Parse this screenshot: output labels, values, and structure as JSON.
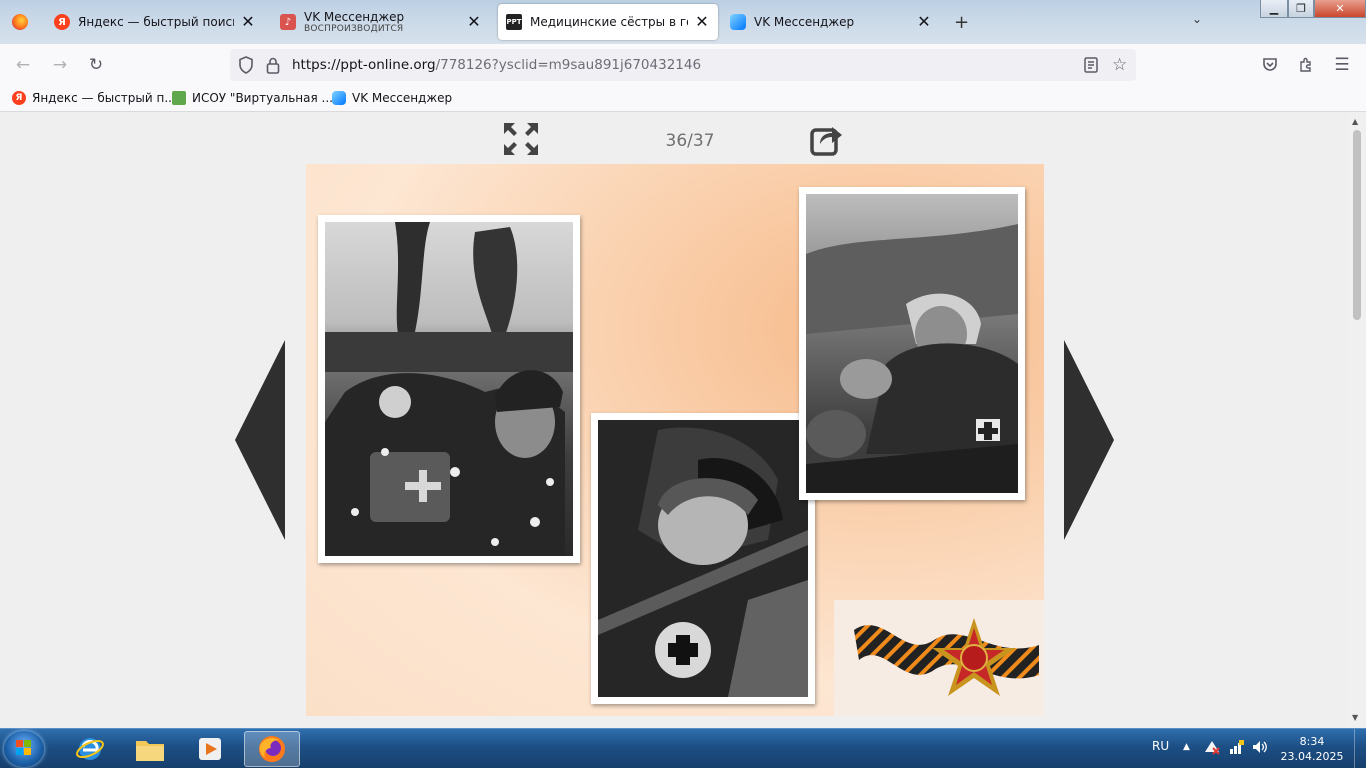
{
  "tabs": [
    {
      "title": "Яндекс — быстрый поиск в ин",
      "favicon": "yandex-icon",
      "active": false
    },
    {
      "title": "VK Мессенджер",
      "subtitle": "ВОСПРОИЗВОДИТСЯ",
      "favicon": "vk-audio-icon",
      "active": false
    },
    {
      "title": "Медицинские сёстры в годы В",
      "favicon": "ppt-icon",
      "active": true
    },
    {
      "title": "VK Мессенджер",
      "favicon": "vk-icon",
      "active": false
    }
  ],
  "close_glyph": "✕",
  "newtab_glyph": "+",
  "tablist_glyph": "⌄",
  "address": {
    "host": "https://ppt-online.org",
    "path": "/778126?ysclid=m9sau891j670432146"
  },
  "bookmarks": [
    {
      "label": "Яндекс — быстрый п...",
      "icon": "yandex-icon"
    },
    {
      "label": "ИСОУ \"Виртуальная ...",
      "icon": "isou-icon"
    },
    {
      "label": "VK Мессенджер",
      "icon": "vk-icon"
    }
  ],
  "viewer": {
    "counter": "36/37"
  },
  "taskbar": {
    "lang": "RU",
    "time": "8:34",
    "date": "23.04.2025"
  },
  "colors": {
    "accent": "#0060df",
    "arrow": "#2f2f2f",
    "slide_bg": "#f7b989"
  }
}
